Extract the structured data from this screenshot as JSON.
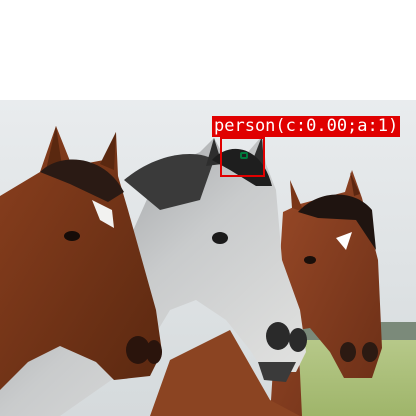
{
  "image": {
    "background": "#ffffff",
    "subject": "three horses (chestnut, dapple grey, bay) in a grassy field"
  },
  "detection": {
    "label": "person(c:0.00;a:1)",
    "box_color": "#e00000",
    "label_text_color": "#ffffff",
    "marker_color": "#007a3d"
  }
}
